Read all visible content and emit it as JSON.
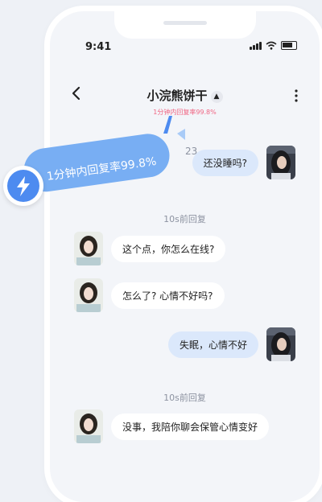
{
  "status_bar": {
    "time": "9:41"
  },
  "header": {
    "title": "小浣熊饼干",
    "subtitle": "1分钟内回复率99.8%"
  },
  "banner": {
    "text": "1分钟内回复率99.8%"
  },
  "partial_time": "23",
  "messages": [
    {
      "side": "right",
      "text": "还没睡吗?"
    },
    {
      "side": "left",
      "text": "这个点，你怎么在线?"
    },
    {
      "side": "left",
      "text": "怎么了? 心情不好吗?"
    },
    {
      "side": "right",
      "text": "失眠，心情不好"
    },
    {
      "side": "left",
      "text": "没事，我陪你聊会保管心情变好"
    }
  ],
  "dividers": [
    "10s前回复",
    "10s前回复"
  ],
  "colors": {
    "accent_blue": "#4d8bf0",
    "banner_blue": "#78aef3",
    "subtitle_pink": "#f06583",
    "my_bubble": "#dbe8fb"
  }
}
